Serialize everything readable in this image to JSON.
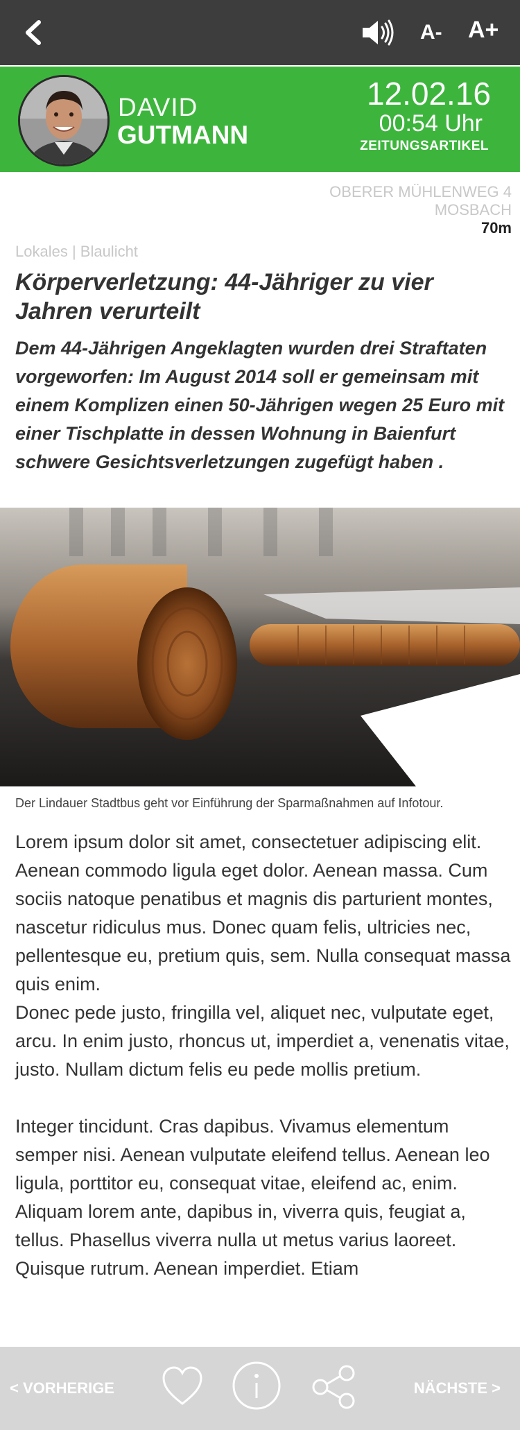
{
  "topbar": {
    "back_icon": "chevron-left-icon",
    "audio_icon": "speaker-icon",
    "font_smaller_label": "A-",
    "font_larger_label": "A+"
  },
  "author": {
    "first_name": "DAVID",
    "last_name": "GUTMANN",
    "avatar": "author-photo"
  },
  "meta": {
    "date": "12.02.16",
    "time": "00:54 Uhr",
    "type": "ZEITUNGSARTIKEL",
    "street": "OBERER MÜHLENWEG 4",
    "city": "MOSBACH",
    "distance": "70m"
  },
  "article": {
    "category": "Lokales | Blaulicht",
    "headline": "Körperverletzung: 44-Jähriger zu vier Jahren verurteilt",
    "lead": "Dem 44-Jährigen Angeklagten wurden drei Straftaten vorgeworfen: Im August 2014 soll er gemeinsam mit einem Komplizen einen 50-Jährigen wegen 25 Euro mit einer Tischplatte in dessen Wohnung in Baienfurt schwere Gesichtsverletzungen zugefügt haben .",
    "image": "gavel-photo",
    "caption": "Der Lindauer Stadtbus geht vor Einführung der Sparmaßnahmen auf Infotour.",
    "paragraphs": [
      "Lorem ipsum dolor sit amet, consectetuer adipiscing elit. Aenean commodo ligula eget dolor. Aenean massa. Cum sociis natoque penatibus et magnis dis parturient montes, nascetur ridiculus mus. Donec quam felis, ultricies nec, pellentesque eu, pretium quis, sem. Nulla consequat massa quis enim.",
      "Donec pede justo, fringilla vel, aliquet nec, vulputate eget, arcu. In enim justo, rhoncus ut, imperdiet a, venenatis vitae, justo. Nullam dictum felis eu pede mollis pretium.",
      "Integer tincidunt. Cras dapibus. Vivamus elementum semper nisi. Aenean vulputate eleifend tellus. Aenean leo ligula, porttitor eu, consequat vitae, eleifend ac, enim. Aliquam lorem ante, dapibus in, viverra quis, feugiat a, tellus. Phasellus viverra nulla ut metus varius laoreet. Quisque rutrum. Aenean imperdiet. Etiam"
    ]
  },
  "bottom_nav": {
    "prev_label": "< VORHERIGE",
    "next_label": "NÄCHSTE >",
    "icons": [
      "heart-icon",
      "info-icon",
      "share-icon"
    ]
  },
  "colors": {
    "topbar": "#3d3d3d",
    "accent_green": "#3db53d",
    "bottombar": "#d6d6d6"
  }
}
